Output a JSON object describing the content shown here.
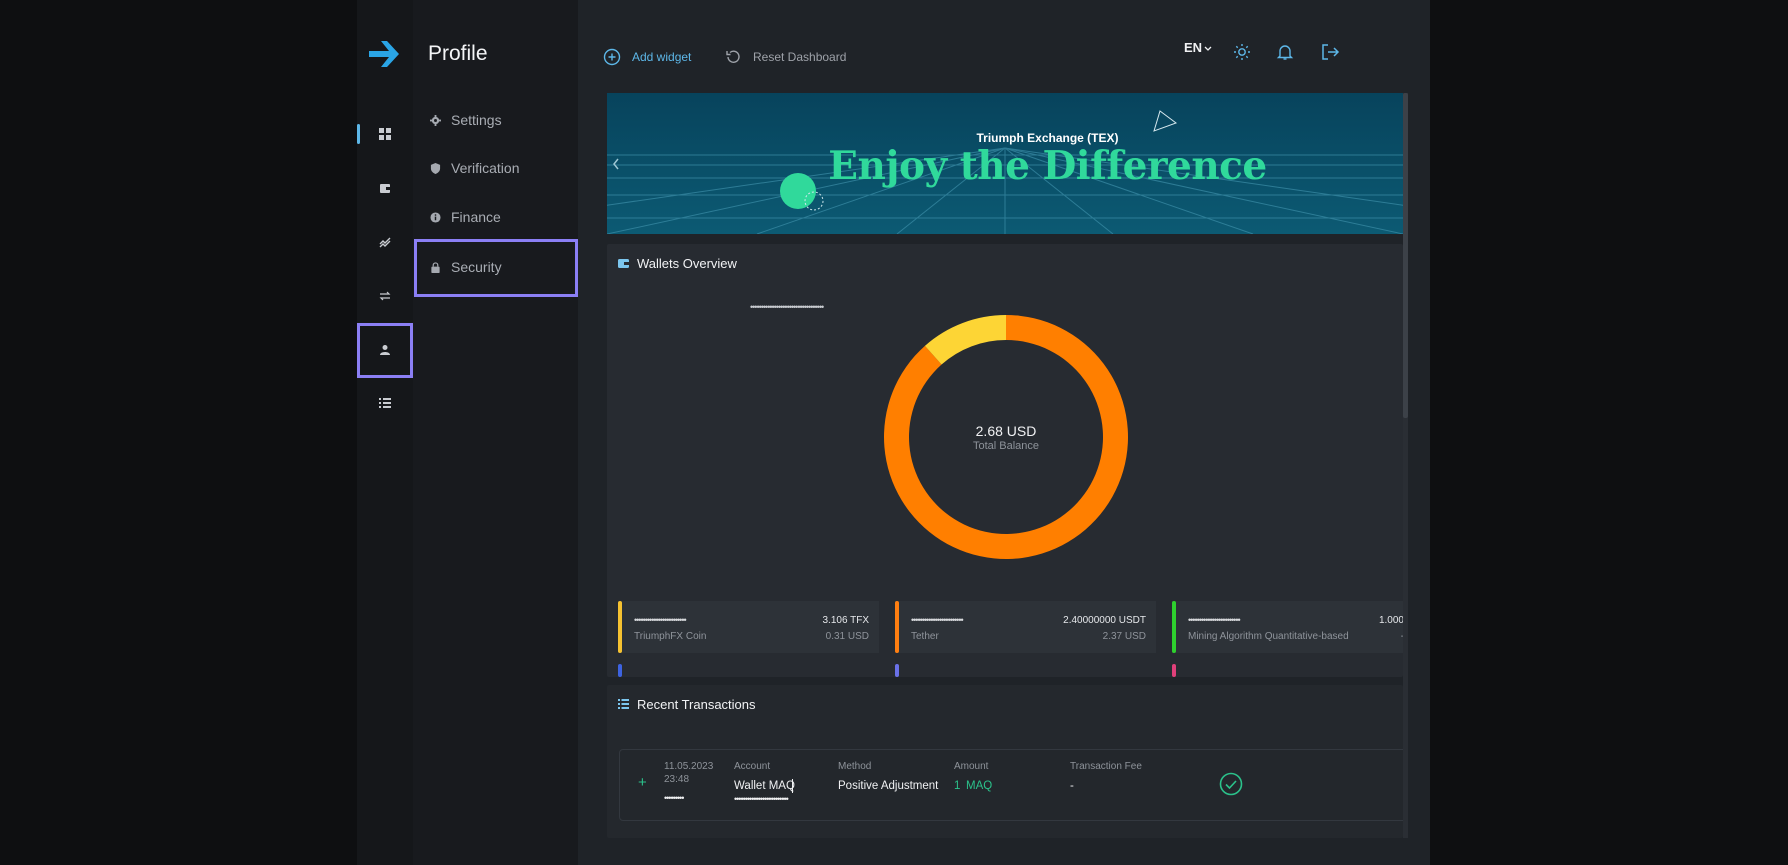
{
  "app": {
    "brand_color": "#2aa5e6",
    "accent_highlight": "#8b7ff5"
  },
  "rail": {
    "items": [
      {
        "icon": "dashboard-icon",
        "active": true
      },
      {
        "icon": "wallet-icon",
        "active": false
      },
      {
        "icon": "chart-icon",
        "active": false
      },
      {
        "icon": "exchange-icon",
        "active": false
      },
      {
        "icon": "user-icon",
        "active": false,
        "highlighted": true
      },
      {
        "icon": "list-icon",
        "active": false
      }
    ]
  },
  "subnav": {
    "title": "Profile",
    "items": [
      {
        "label": "Settings",
        "icon": "gear-icon"
      },
      {
        "label": "Verification",
        "icon": "shield-icon"
      },
      {
        "label": "Finance",
        "icon": "info-icon"
      },
      {
        "label": "Security",
        "icon": "lock-icon",
        "highlighted": true
      }
    ]
  },
  "topbar": {
    "add_widget": "Add widget",
    "reset_dashboard": "Reset Dashboard",
    "language": "EN"
  },
  "banner": {
    "small": "Triumph Exchange (TEX)",
    "big": "Enjoy the Difference"
  },
  "wallets_overview": {
    "title": "Wallets Overview",
    "masked_header": "••••••••••••••••••••••••••••••••••",
    "total_value": "2.68 USD",
    "total_label": "Total Balance",
    "wallets": [
      {
        "mask": "••••••••••••••••••••••••",
        "name": "TriumphFX Coin",
        "amount": "3.106 TFX",
        "usd": "0.31 USD",
        "color": "#f6c231"
      },
      {
        "mask": "••••••••••••••••••••••••",
        "name": "Tether",
        "amount": "2.40000000 USDT",
        "usd": "2.37 USD",
        "color": "#ff7f11"
      },
      {
        "mask": "••••••••••••••••••••••••",
        "name": "Mining Algorithm Quantitative-based",
        "amount": "1.000",
        "usd": "-",
        "color": "#2ed12e"
      }
    ]
  },
  "chart_data": {
    "type": "pie",
    "categories": [
      "Tether",
      "TriumphFX Coin"
    ],
    "values": [
      2.37,
      0.31
    ],
    "colors": [
      "#ff7f00",
      "#fdd535"
    ],
    "donut": true,
    "center_text": "2.68 USD"
  },
  "recent_transactions": {
    "title": "Recent Transactions",
    "rows": [
      {
        "date": "11.05.2023",
        "time": "23:48",
        "masked_id": "•••••••••",
        "account_label": "Account",
        "account": "Wallet MAQ",
        "account_mask": "•••••••••••••••••••••••••",
        "method_label": "Method",
        "method": "Positive Adjustment",
        "amount_label": "Amount",
        "amount_value": "1",
        "amount_currency": "MAQ",
        "fee_label": "Transaction Fee",
        "fee": "-"
      }
    ]
  }
}
